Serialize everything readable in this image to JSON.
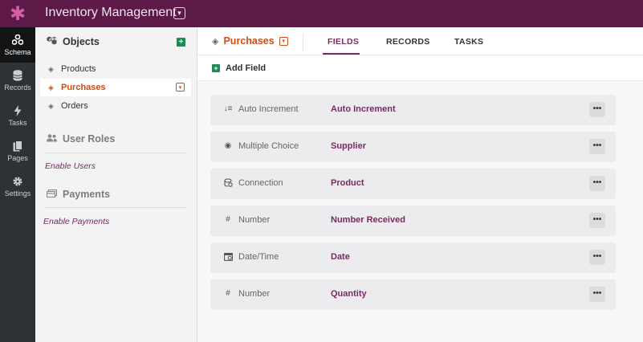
{
  "app": {
    "title": "Inventory Management",
    "logo": "asterisk-logo"
  },
  "rail": [
    {
      "label": "Schema",
      "icon": "schema-icon",
      "active": true
    },
    {
      "label": "Records",
      "icon": "database-icon"
    },
    {
      "label": "Tasks",
      "icon": "bolt-icon"
    },
    {
      "label": "Pages",
      "icon": "pages-icon"
    },
    {
      "label": "Settings",
      "icon": "gear-icon"
    }
  ],
  "sidebar": {
    "objects_heading": "Objects",
    "objects": [
      {
        "label": "Products"
      },
      {
        "label": "Purchases",
        "active": true
      },
      {
        "label": "Orders"
      }
    ],
    "user_roles_heading": "User Roles",
    "enable_users": "Enable Users",
    "payments_heading": "Payments",
    "enable_payments": "Enable Payments"
  },
  "main": {
    "object_title": "Purchases",
    "tabs": [
      {
        "label": "FIELDS",
        "active": true
      },
      {
        "label": "RECORDS"
      },
      {
        "label": "TASKS"
      }
    ],
    "add_field_label": "Add Field",
    "more_glyph": "•••",
    "fields": [
      {
        "type": "Auto Increment",
        "name": "Auto Increment",
        "icon": "sort-icon"
      },
      {
        "type": "Multiple Choice",
        "name": "Supplier",
        "icon": "radio-icon"
      },
      {
        "type": "Connection",
        "name": "Product",
        "icon": "connection-icon"
      },
      {
        "type": "Number",
        "name": "Number Received",
        "icon": "hash-icon"
      },
      {
        "type": "Date/Time",
        "name": "Date",
        "icon": "calendar-icon"
      },
      {
        "type": "Number",
        "name": "Quantity",
        "icon": "hash-icon"
      }
    ]
  },
  "colors": {
    "topbar": "#5d1a49",
    "accent": "#7a2a62",
    "active_object": "#cf4d16",
    "add_green": "#1d8a54",
    "rail": "#2e3235"
  }
}
